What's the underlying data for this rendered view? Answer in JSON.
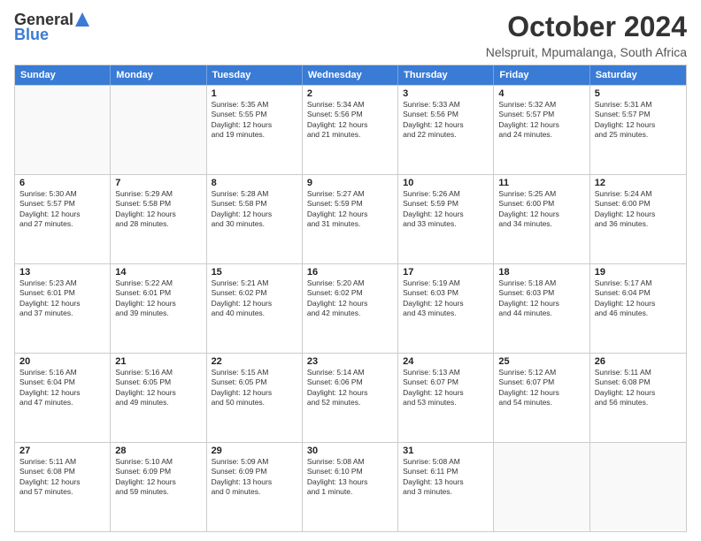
{
  "logo": {
    "general": "General",
    "blue": "Blue"
  },
  "title": "October 2024",
  "subtitle": "Nelspruit, Mpumalanga, South Africa",
  "days_of_week": [
    "Sunday",
    "Monday",
    "Tuesday",
    "Wednesday",
    "Thursday",
    "Friday",
    "Saturday"
  ],
  "weeks": [
    [
      {
        "day": "",
        "info": ""
      },
      {
        "day": "",
        "info": ""
      },
      {
        "day": "1",
        "info": "Sunrise: 5:35 AM\nSunset: 5:55 PM\nDaylight: 12 hours\nand 19 minutes."
      },
      {
        "day": "2",
        "info": "Sunrise: 5:34 AM\nSunset: 5:56 PM\nDaylight: 12 hours\nand 21 minutes."
      },
      {
        "day": "3",
        "info": "Sunrise: 5:33 AM\nSunset: 5:56 PM\nDaylight: 12 hours\nand 22 minutes."
      },
      {
        "day": "4",
        "info": "Sunrise: 5:32 AM\nSunset: 5:57 PM\nDaylight: 12 hours\nand 24 minutes."
      },
      {
        "day": "5",
        "info": "Sunrise: 5:31 AM\nSunset: 5:57 PM\nDaylight: 12 hours\nand 25 minutes."
      }
    ],
    [
      {
        "day": "6",
        "info": "Sunrise: 5:30 AM\nSunset: 5:57 PM\nDaylight: 12 hours\nand 27 minutes."
      },
      {
        "day": "7",
        "info": "Sunrise: 5:29 AM\nSunset: 5:58 PM\nDaylight: 12 hours\nand 28 minutes."
      },
      {
        "day": "8",
        "info": "Sunrise: 5:28 AM\nSunset: 5:58 PM\nDaylight: 12 hours\nand 30 minutes."
      },
      {
        "day": "9",
        "info": "Sunrise: 5:27 AM\nSunset: 5:59 PM\nDaylight: 12 hours\nand 31 minutes."
      },
      {
        "day": "10",
        "info": "Sunrise: 5:26 AM\nSunset: 5:59 PM\nDaylight: 12 hours\nand 33 minutes."
      },
      {
        "day": "11",
        "info": "Sunrise: 5:25 AM\nSunset: 6:00 PM\nDaylight: 12 hours\nand 34 minutes."
      },
      {
        "day": "12",
        "info": "Sunrise: 5:24 AM\nSunset: 6:00 PM\nDaylight: 12 hours\nand 36 minutes."
      }
    ],
    [
      {
        "day": "13",
        "info": "Sunrise: 5:23 AM\nSunset: 6:01 PM\nDaylight: 12 hours\nand 37 minutes."
      },
      {
        "day": "14",
        "info": "Sunrise: 5:22 AM\nSunset: 6:01 PM\nDaylight: 12 hours\nand 39 minutes."
      },
      {
        "day": "15",
        "info": "Sunrise: 5:21 AM\nSunset: 6:02 PM\nDaylight: 12 hours\nand 40 minutes."
      },
      {
        "day": "16",
        "info": "Sunrise: 5:20 AM\nSunset: 6:02 PM\nDaylight: 12 hours\nand 42 minutes."
      },
      {
        "day": "17",
        "info": "Sunrise: 5:19 AM\nSunset: 6:03 PM\nDaylight: 12 hours\nand 43 minutes."
      },
      {
        "day": "18",
        "info": "Sunrise: 5:18 AM\nSunset: 6:03 PM\nDaylight: 12 hours\nand 44 minutes."
      },
      {
        "day": "19",
        "info": "Sunrise: 5:17 AM\nSunset: 6:04 PM\nDaylight: 12 hours\nand 46 minutes."
      }
    ],
    [
      {
        "day": "20",
        "info": "Sunrise: 5:16 AM\nSunset: 6:04 PM\nDaylight: 12 hours\nand 47 minutes."
      },
      {
        "day": "21",
        "info": "Sunrise: 5:16 AM\nSunset: 6:05 PM\nDaylight: 12 hours\nand 49 minutes."
      },
      {
        "day": "22",
        "info": "Sunrise: 5:15 AM\nSunset: 6:05 PM\nDaylight: 12 hours\nand 50 minutes."
      },
      {
        "day": "23",
        "info": "Sunrise: 5:14 AM\nSunset: 6:06 PM\nDaylight: 12 hours\nand 52 minutes."
      },
      {
        "day": "24",
        "info": "Sunrise: 5:13 AM\nSunset: 6:07 PM\nDaylight: 12 hours\nand 53 minutes."
      },
      {
        "day": "25",
        "info": "Sunrise: 5:12 AM\nSunset: 6:07 PM\nDaylight: 12 hours\nand 54 minutes."
      },
      {
        "day": "26",
        "info": "Sunrise: 5:11 AM\nSunset: 6:08 PM\nDaylight: 12 hours\nand 56 minutes."
      }
    ],
    [
      {
        "day": "27",
        "info": "Sunrise: 5:11 AM\nSunset: 6:08 PM\nDaylight: 12 hours\nand 57 minutes."
      },
      {
        "day": "28",
        "info": "Sunrise: 5:10 AM\nSunset: 6:09 PM\nDaylight: 12 hours\nand 59 minutes."
      },
      {
        "day": "29",
        "info": "Sunrise: 5:09 AM\nSunset: 6:09 PM\nDaylight: 13 hours\nand 0 minutes."
      },
      {
        "day": "30",
        "info": "Sunrise: 5:08 AM\nSunset: 6:10 PM\nDaylight: 13 hours\nand 1 minute."
      },
      {
        "day": "31",
        "info": "Sunrise: 5:08 AM\nSunset: 6:11 PM\nDaylight: 13 hours\nand 3 minutes."
      },
      {
        "day": "",
        "info": ""
      },
      {
        "day": "",
        "info": ""
      }
    ]
  ]
}
